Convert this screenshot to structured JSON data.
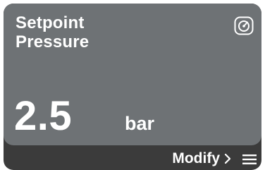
{
  "tile": {
    "title_line1": "Setpoint",
    "title_line2": "Pressure",
    "value": "2.5",
    "unit": "bar",
    "icon": "pressure-gauge-icon"
  },
  "footer": {
    "modify_label": "Modify",
    "chevron_icon": "chevron-right-icon",
    "menu_icon": "hamburger-menu-icon"
  },
  "colors": {
    "panel": "#6e7275",
    "footer": "#3b3b3b",
    "text": "#ffffff"
  }
}
